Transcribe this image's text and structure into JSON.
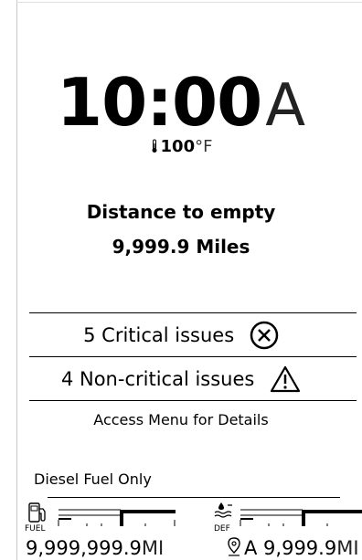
{
  "clock": {
    "time": "10:00",
    "ampm": "A"
  },
  "temperature": {
    "value": "100",
    "unit": "°F",
    "icon": "thermometer-icon"
  },
  "distance_to_empty": {
    "title": "Distance to empty",
    "value": "9,999.9 Miles"
  },
  "issues": {
    "critical_label": "5 Critical issues",
    "critical_icon": "x-circle-icon",
    "noncritical_label": "4 Non-critical issues",
    "noncritical_icon": "warning-triangle-icon"
  },
  "access_text": "Access Menu for Details",
  "fuel_type": "Diesel Fuel Only",
  "gauges": {
    "fuel": {
      "label": "FUEL",
      "icon": "fuel-pump-icon",
      "reading": "9,999,999.9",
      "unit": "MI"
    },
    "def": {
      "label": "DEF",
      "icon": "def-fluid-icon",
      "reading_prefix": "A 9,999.9",
      "unit": "MI",
      "pin_icon": "location-pin-icon"
    }
  }
}
